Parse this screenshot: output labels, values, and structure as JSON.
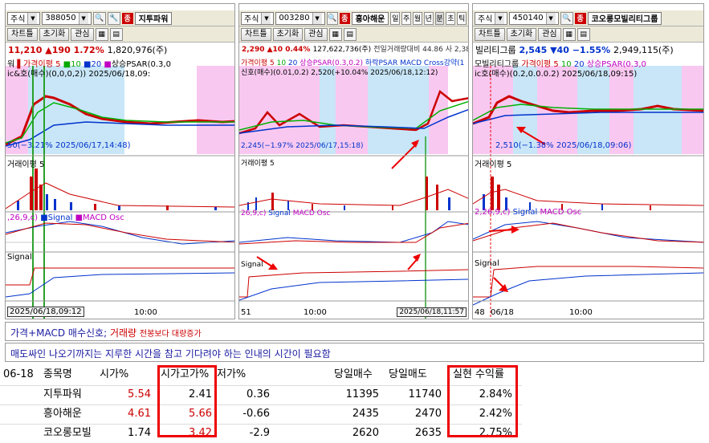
{
  "panels": [
    {
      "combo_label": "주식",
      "code": "388050",
      "name": "지투파워",
      "toolbar2": [
        "차트틀",
        "초기화",
        "관심"
      ],
      "price": "11,210",
      "change": "▲190",
      "change_pct": "1.72%",
      "volume": "1,820,976(주)",
      "legend_main": "가격이평 5",
      "legend_ma10": "10",
      "legend_ma20": "20",
      "legend_psar": "상승PSAR(0.3,0",
      "legend_signal": "ic&호(매수)(0,0,0,2)) 2025/06/18,09:",
      "low_label": "50(−3.21% 2025/06/17,14:48)",
      "vol_legend": "거래이평 5",
      "macd_legend": ",26,9,c)",
      "macd_signal": "Signal",
      "macd_osc": "MACD Osc",
      "sig_legend": "Signal",
      "date_label": "2025/06/18,09:12",
      "time_label": "10:00",
      "left_label": "워"
    },
    {
      "combo_label": "주식",
      "code": "003280",
      "name": "흥아해운",
      "periods": [
        "일",
        "주",
        "월",
        "년",
        "분",
        "초",
        "틱"
      ],
      "toolbar2": [
        "차트틀",
        "초기화",
        "관심"
      ],
      "price": "2,290",
      "change": "▲10",
      "change_pct": "0.44%",
      "volume": "127,622,736(주)",
      "extra": "전일거래량대비 44.86 사 2,38",
      "legend_main": "가격이평 5",
      "legend_ma10": "10",
      "legend_ma20": "20",
      "legend_psar": "상승PSAR(0.3,0.2)",
      "legend_down": "하락PSAR",
      "legend_cross": "MACD Cross강약(1",
      "legend_signal": "신호(매수)(0.01,0.2)",
      "high_label": "2,520(+10.04% 2025/06/18,12:12)",
      "low_label": "2,245(−1.97% 2025/06/17,15:18)",
      "vol_legend": "거래이평 5",
      "macd_legend": "26,9,c)",
      "macd_signal": "Signal",
      "macd_osc": "MACD Osc",
      "sig_legend": "Signal",
      "date_label": "2025/06/18,11:57",
      "time_label": "10:00",
      "left_label": "51"
    },
    {
      "combo_label": "주식",
      "code": "450140",
      "name": "코오롱모빌리티그룹",
      "toolbar2": [
        "차트틀",
        "초기화",
        "관심"
      ],
      "price_prefix": "빌리티그룹",
      "price": "2,545",
      "change": "▼40",
      "change_pct": "−1.55%",
      "volume": "2,949,115(주)",
      "legend_main": "모빌리티그룹",
      "legend_ma": "가격이평 5",
      "legend_ma10": "10",
      "legend_ma20": "20",
      "legend_psar": "상승PSAR(0.3,0",
      "legend_signal": "ic호(매수)(0.2,0.0.0.2) 2025/06/18,09:15)",
      "low_label": "2,510(−1.38% 2025/06/18,09:06)",
      "vol_legend": "거래이평 5",
      "macd_legend": "2,26,9,c)",
      "macd_signal": "Signal",
      "macd_osc": "MACD Osc",
      "sig_legend": "Signal",
      "date_label": "06/18",
      "time_label": "10:00",
      "left_label": "48"
    }
  ],
  "notes": {
    "line1_a": "가격+MACD 매수신호;",
    "line1_b": "거래량",
    "line1_c": "전봉보다 대량증가",
    "line2": "매도싸인 나오기까지는 지루한 시간을 참고 기다려야 하는 인내의 시간이 필요함"
  },
  "table": {
    "headers": [
      "06-18",
      "종목명",
      "시가%",
      "시가고가%",
      "저가%",
      "당일매수",
      "당일매도",
      "실현 수익률"
    ],
    "rows": [
      {
        "name": "지투파워",
        "open": "5.54",
        "open_high": "2.41",
        "low": "0.36",
        "buy": "11395",
        "sell": "11740",
        "profit": "2.84%"
      },
      {
        "name": "흥아해운",
        "open": "4.61",
        "open_high": "5.66",
        "low": "-0.66",
        "buy": "2435",
        "sell": "2470",
        "profit": "2.42%"
      },
      {
        "name": "코오롱모빌",
        "open": "1.74",
        "open_high": "3.42",
        "low": "-2.9",
        "buy": "2620",
        "sell": "2635",
        "profit": "2.75%"
      }
    ]
  },
  "colors": {
    "accent_red": "#c00000",
    "ma_green": "#00b000",
    "ma_blue": "#0033cc",
    "zone_pink": "#f9c8f0",
    "zone_blue": "#c8e6f8",
    "signal_line": "#2aa02a"
  }
}
